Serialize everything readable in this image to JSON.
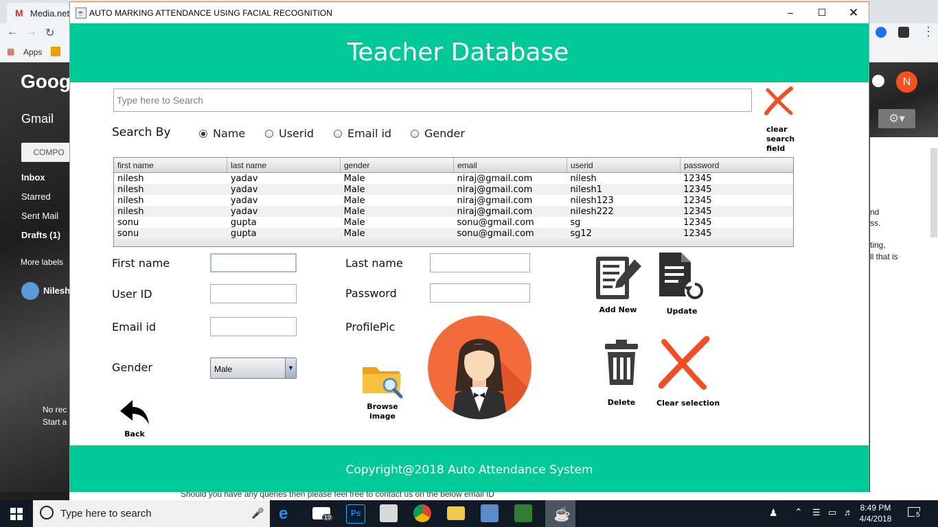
{
  "browser": {
    "tab_title": "Media.net",
    "bookmark_apps": "Apps"
  },
  "gmail": {
    "logo": "Goog",
    "app_label": "Gmail",
    "compose": "COMPO",
    "nav": [
      "Inbox",
      "Starred",
      "Sent Mail",
      "Drafts (1)",
      "More labels"
    ],
    "user": "Nilesh",
    "avatar_letter": "N",
    "empty_line1": "No rec",
    "empty_line2": "Start a",
    "right_snippet": [
      "nd",
      "ss.",
      "ting,",
      "ll that is"
    ],
    "bottom_text": "Should you have any queries then please feel free to contact us on the below email ID"
  },
  "window": {
    "title": "AUTO MARKING ATTENDANCE USING FACIAL RECOGNITION",
    "header": "Teacher Database",
    "footer": "Copyright@2018 Auto Attendance System"
  },
  "search": {
    "placeholder": "Type here to Search",
    "search_by_label": "Search By",
    "options": [
      {
        "label": "Name",
        "selected": true
      },
      {
        "label": "Userid",
        "selected": false
      },
      {
        "label": "Email id",
        "selected": false
      },
      {
        "label": "Gender",
        "selected": false
      }
    ],
    "clear_label_1": "clear",
    "clear_label_2": "search",
    "clear_label_3": "field"
  },
  "table": {
    "columns": [
      "first name",
      "last name",
      "gender",
      "email",
      "userid",
      "password"
    ],
    "rows": [
      [
        "nilesh",
        "yadav",
        "Male",
        "niraj@gmail.com",
        "nilesh",
        "12345"
      ],
      [
        "nilesh",
        "yadav",
        "Male",
        "niraj@gmail.com",
        "nilesh1",
        "12345"
      ],
      [
        "nilesh",
        "yadav",
        "Male",
        "niraj@gmail.com",
        "nilesh123",
        "12345"
      ],
      [
        "nilesh",
        "yadav",
        "Male",
        "niraj@gmail.com",
        "nilesh222",
        "12345"
      ],
      [
        "sonu",
        "gupta",
        "Male",
        "sonu@gmail.com",
        "sg",
        "12345"
      ],
      [
        "sonu",
        "gupta",
        "Male",
        "sonu@gmail.com",
        "sg12",
        "12345"
      ]
    ]
  },
  "form": {
    "first_name_label": "First name",
    "last_name_label": "Last name",
    "user_id_label": "User ID",
    "password_label": "Password",
    "email_label": "Email id",
    "profile_pic_label": "ProfilePic",
    "gender_label": "Gender",
    "first_name_value": "",
    "last_name_value": "",
    "user_id_value": "",
    "password_value": "",
    "email_value": "",
    "gender_value": "Male"
  },
  "actions": {
    "add_new": "Add New",
    "update": "Update",
    "delete": "Delete",
    "clear_selection": "Clear selection",
    "browse_1": "Browse",
    "browse_2": "image",
    "back": "Back"
  },
  "taskbar": {
    "search_placeholder": "Type here to search",
    "time": "8:49 PM",
    "date": "4/4/2018",
    "mail_count": "19",
    "notif_count": "5"
  },
  "colors": {
    "accent": "#00c897",
    "x_mark": "#f04e23",
    "avatar_bg": "#f26b3a"
  }
}
